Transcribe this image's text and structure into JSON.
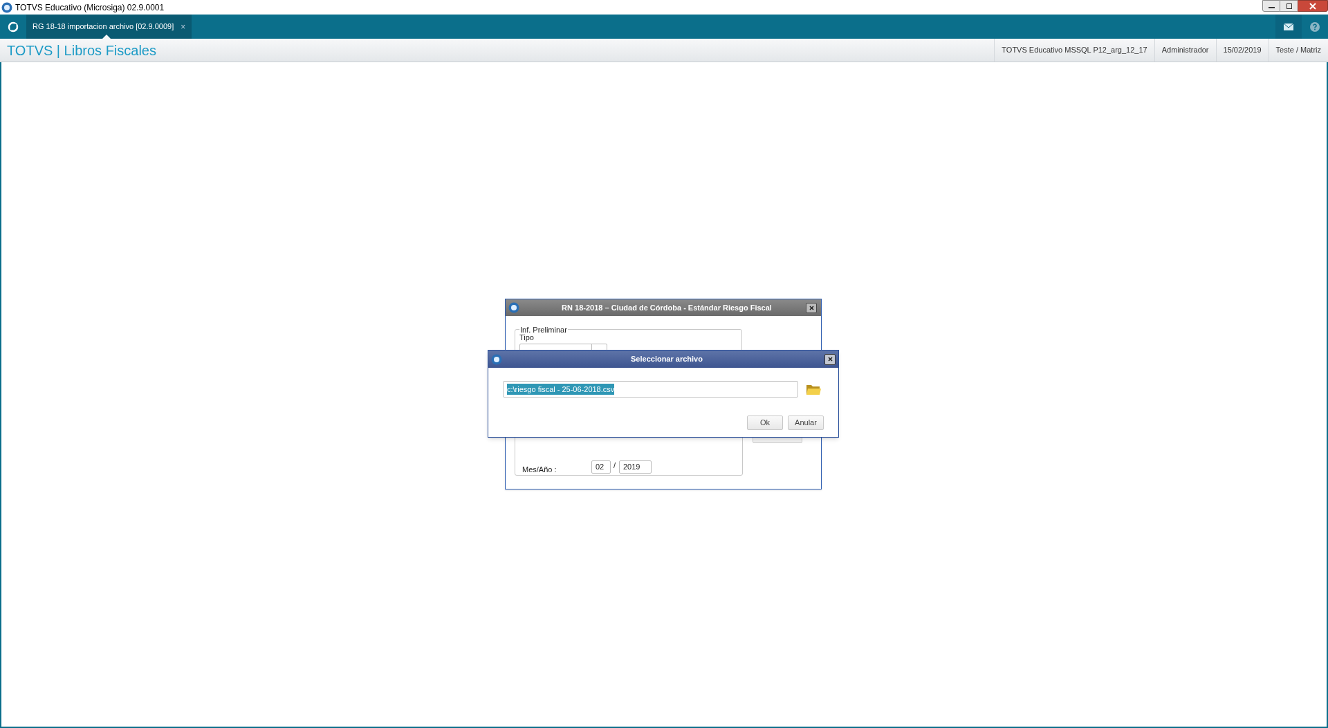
{
  "window": {
    "title": "TOTVS Educativo (Microsiga) 02.9.0001"
  },
  "tabs": [
    {
      "label": "RG 18-18 importacion archivo [02.9.0009]",
      "close": "×",
      "selected": true
    }
  ],
  "header": {
    "title": "TOTVS | Libros Fiscales",
    "info": [
      "TOTVS Educativo MSSQL P12_arg_12_17",
      "Administrador",
      "15/02/2019",
      "Teste / Matriz"
    ]
  },
  "back_dialog": {
    "title": "RN 18-2018 – Ciudad de Córdoba - Estándar Riesgo Fiscal",
    "group_label": "Inf. Preliminar",
    "tipo_label": "Tipo",
    "period_label": "Mes/Año :",
    "month": "02",
    "separator": "/",
    "year": "2019"
  },
  "file_dialog": {
    "title": "Seleccionar archivo",
    "path": "c:\\riesgo fiscal - 25-06-2018.csv",
    "buttons": [
      "Ok",
      "Anular"
    ]
  }
}
